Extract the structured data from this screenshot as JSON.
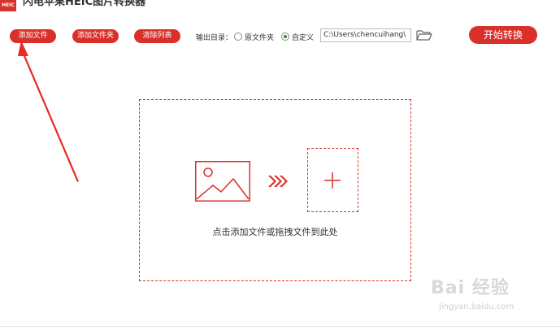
{
  "app": {
    "logo_text": "HEIC",
    "title": "闪电苹果HEIC图片转换器"
  },
  "toolbar": {
    "add_file_label": "添加文件",
    "add_folder_label": "添加文件夹",
    "clear_list_label": "清除列表",
    "output_dir_label": "输出目录：",
    "option_original_label": "原文件夹",
    "option_custom_label": "自定义",
    "selected_option": "custom",
    "output_path_value": "C:\\Users\\chencuihang\\",
    "start_label": "开始转换"
  },
  "dropzone": {
    "hint": "点击添加文件或拖拽文件到此处"
  },
  "watermark": {
    "main": "Bai 经验",
    "sub": "jingyan.baidu.com"
  },
  "colors": {
    "accent": "#d9302b",
    "radio_checked": "#2c8a2c"
  },
  "icons": {
    "folder": "folder-open-icon",
    "image": "image-placeholder-icon",
    "arrows": "triple-arrow-right-icon",
    "plus": "plus-icon"
  }
}
